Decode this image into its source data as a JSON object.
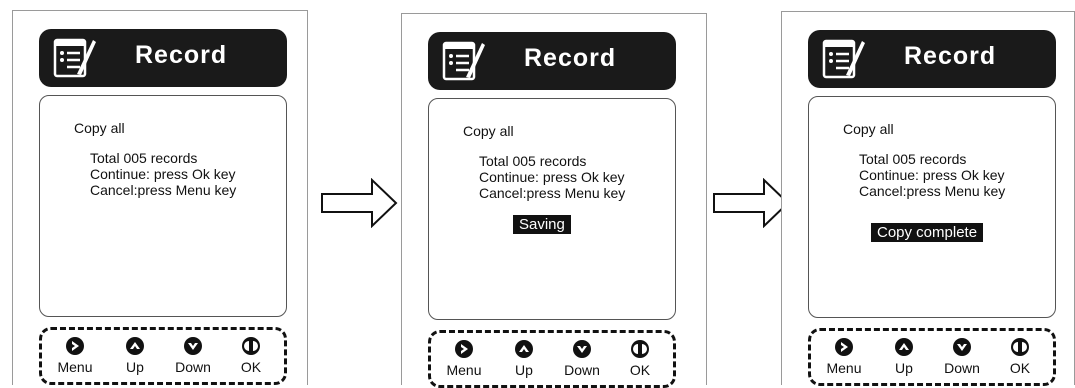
{
  "screens": [
    {
      "title": "Record",
      "lines": {
        "copy": "Copy all",
        "total": "Total 005 records",
        "continue": "Continue: press Ok key",
        "cancel": "Cancel:press Menu key"
      },
      "status": ""
    },
    {
      "title": "Record",
      "lines": {
        "copy": "Copy all",
        "total": "Total 005 records",
        "continue": "Continue: press Ok key",
        "cancel": "Cancel:press Menu key"
      },
      "status": "Saving"
    },
    {
      "title": "Record",
      "lines": {
        "copy": "Copy all",
        "total": "Total 005 records",
        "continue": "Continue: press Ok key",
        "cancel": "Cancel:press Menu key"
      },
      "status": "Copy complete"
    }
  ],
  "keys": {
    "menu": "Menu",
    "up": "Up",
    "down": "Down",
    "ok": "OK"
  },
  "icons": {
    "header": "record-notepad-icon",
    "menu": "right-arrow-circle-icon",
    "up": "up-arrow-circle-icon",
    "down": "down-arrow-circle-icon",
    "ok": "ok-circle-icon",
    "flow": "hollow-right-arrow-icon"
  },
  "colors": {
    "header_bg": "#1a1a1a",
    "status_bg": "#111111"
  }
}
